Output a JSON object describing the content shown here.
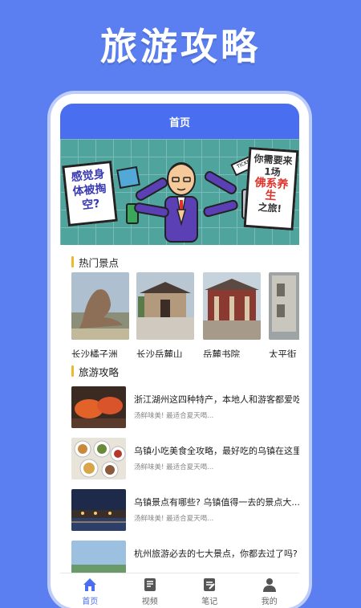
{
  "promo": {
    "title": "旅游攻略"
  },
  "header": {
    "title": "首页"
  },
  "banner": {
    "left_text": "感觉身体被掏空?",
    "right_text_top": "你需要来1场",
    "right_text_red": "佛系养生",
    "right_text_bottom": "之旅!",
    "ticket_text": "TICKET"
  },
  "hot_spots": {
    "title": "热门景点",
    "items": [
      {
        "label": "长沙橘子洲",
        "icon": "statue-photo"
      },
      {
        "label": "长沙岳麓山",
        "icon": "temple-photo"
      },
      {
        "label": "岳麓书院",
        "icon": "academy-photo"
      },
      {
        "label": "太平街",
        "icon": "street-photo"
      }
    ]
  },
  "guides": {
    "title": "旅游攻略",
    "items": [
      {
        "title": "浙江湖州这四种特产，本地人和游客都爱吃",
        "subtitle": "汤鲜味美! 最适合夏天喝..."
      },
      {
        "title": "乌镇小吃美食全攻略，最好吃的乌镇在这里",
        "subtitle": "汤鲜味美! 最适合夏天喝..."
      },
      {
        "title": "乌镇景点有哪些? 乌镇值得一去的景点大...",
        "subtitle": "汤鲜味美! 最适合夏天喝..."
      },
      {
        "title": "杭州旅游必去的七大景点，你都去过了吗?",
        "subtitle": ""
      }
    ]
  },
  "tabbar": {
    "items": [
      {
        "label": "首页",
        "icon": "home-icon",
        "active": true
      },
      {
        "label": "视频",
        "icon": "video-icon",
        "active": false
      },
      {
        "label": "笔记",
        "icon": "note-icon",
        "active": false
      },
      {
        "label": "我的",
        "icon": "profile-icon",
        "active": false
      }
    ]
  },
  "colors": {
    "accent": "#4a6ef0",
    "background": "#5b7ff0",
    "section_bar": "#f0b830"
  }
}
